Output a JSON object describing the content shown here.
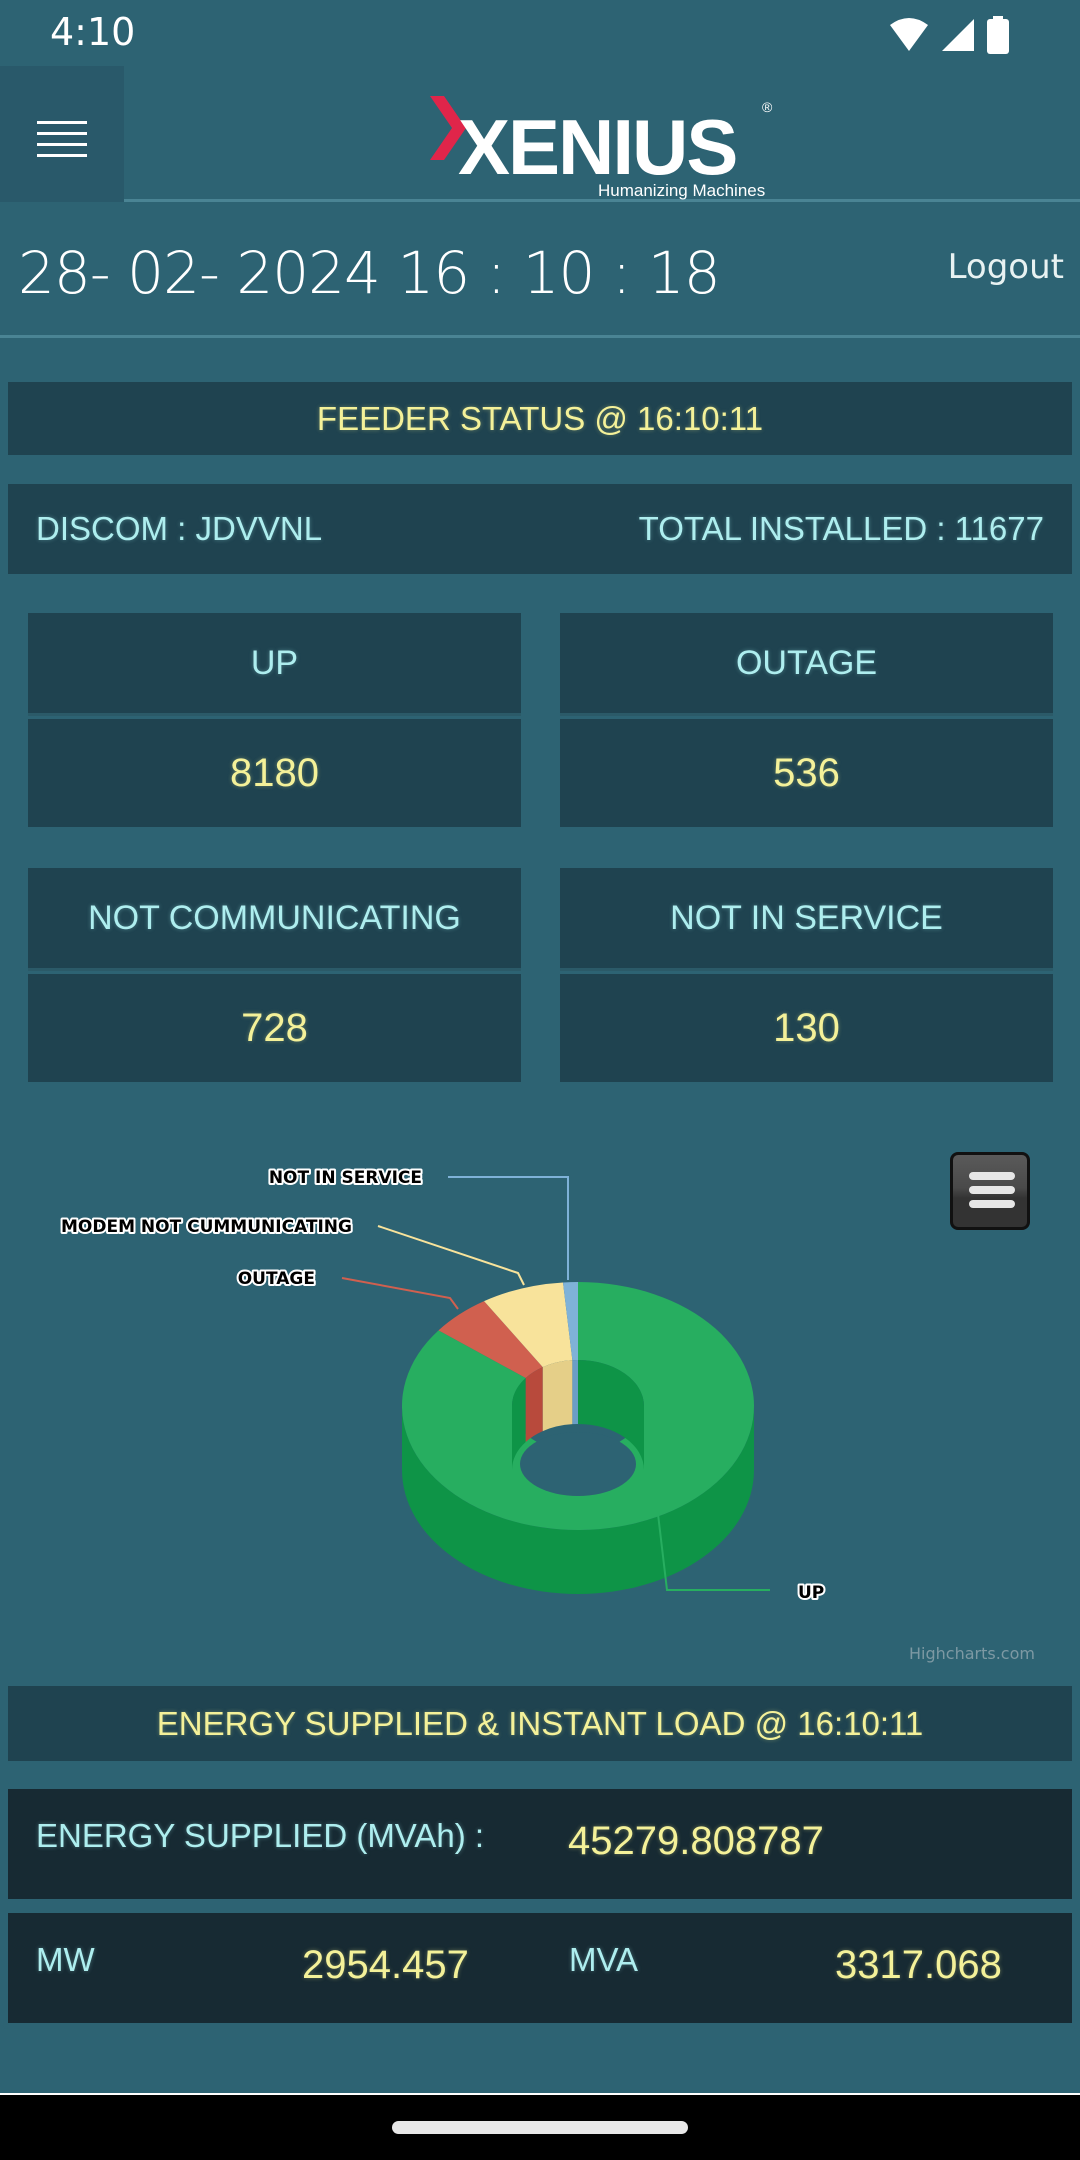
{
  "status_bar": {
    "time": "4:10",
    "icons": [
      "wifi-icon",
      "cellular-signal-icon",
      "battery-icon"
    ]
  },
  "header": {
    "menu_icon": "hamburger-menu-icon",
    "logo_text": "XENIUS",
    "logo_tagline": "Humanizing Machines",
    "logo_registered": "®",
    "brand_colors": {
      "accent_red": "#e0254a",
      "logo_white": "#ffffff"
    }
  },
  "datetime_row": {
    "datetime": "28- 02- 2024 16 : 10 : 18",
    "logout_label": "Logout"
  },
  "feeder_status": {
    "title": "FEEDER STATUS @ 16:10:11",
    "discom": "DISCOM : JDVVNL",
    "total_installed": "TOTAL INSTALLED : 11677",
    "cards": [
      {
        "label": "UP",
        "value": "8180"
      },
      {
        "label": "OUTAGE",
        "value": "536"
      },
      {
        "label": "NOT COMMUNICATING",
        "value": "728"
      },
      {
        "label": "NOT IN SERVICE",
        "value": "130"
      }
    ]
  },
  "chart_data": {
    "type": "pie",
    "variant": "3d-donut",
    "title": "",
    "slices": [
      {
        "name": "UP",
        "value": 8180,
        "color": "#27ae60",
        "side_color": "#0e9447"
      },
      {
        "name": "OUTAGE",
        "value": 536,
        "color": "#d0604f",
        "side_color": "#b84a3c"
      },
      {
        "name": "MODEM NOT CUMMUNICATING",
        "value": 728,
        "color": "#f8e39b",
        "side_color": "#e5cf88"
      },
      {
        "name": "NOT IN SERVICE",
        "value": 130,
        "color": "#7fb2d8",
        "side_color": "#6b9ec6"
      }
    ],
    "start_angle_deg": 0,
    "direction": "clockwise-from-top",
    "labels_outside": true,
    "export_menu_icon": "chart-context-menu-icon",
    "credits": "Highcharts.com"
  },
  "energy": {
    "title": "ENERGY SUPPLIED & INSTANT LOAD @ 16:10:11",
    "energy_supplied_label": "ENERGY SUPPLIED (MVAh) :",
    "energy_supplied_value": "45279.808787",
    "mw_label": "MW",
    "mw_value": "2954.457",
    "mva_label": "MVA",
    "mva_value": "3317.068"
  }
}
